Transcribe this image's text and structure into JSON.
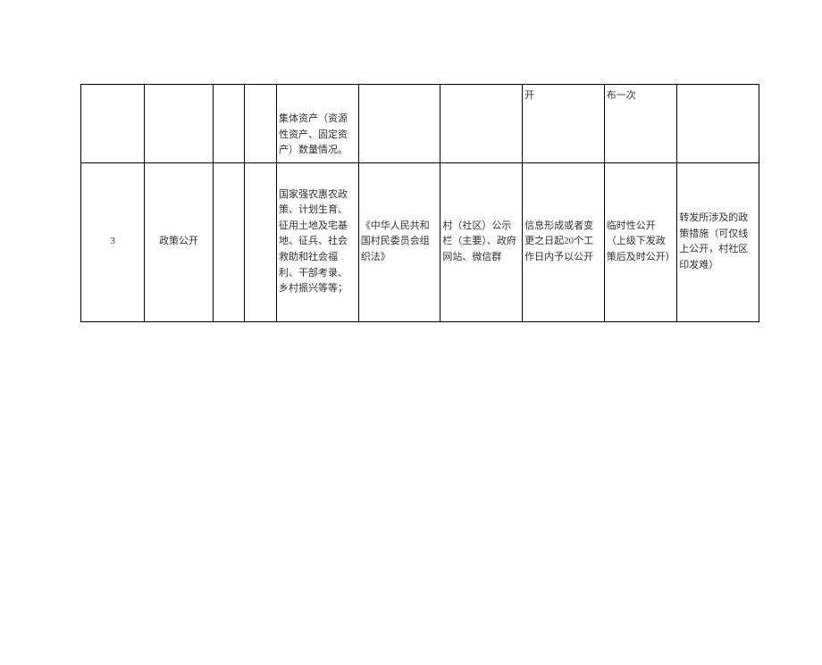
{
  "rows": {
    "partial": {
      "col5": "集体资产（资源性资产、固定资产）数量情况。",
      "col8": "开",
      "col9": "布一次"
    },
    "row3": {
      "num": "3",
      "category": "政策公开",
      "sub": "",
      "item": "",
      "content": "国家强农惠农政策、计划生育、征用土地及宅基地、征兵、社会救助和社会福利、干部考录、乡村振兴等等；",
      "basis": "《中华人民共和国村民委员会组织法》",
      "channel": "村（社区）公示栏（主要）、政府网站、微信群",
      "time": "信息形成或者变更之日起20个工作日内予以公开",
      "type": "临时性公开（上级下发政策后及时公开）",
      "note": "转发所涉及的政策措施（可仅线上公开，村社区印发难）"
    }
  }
}
